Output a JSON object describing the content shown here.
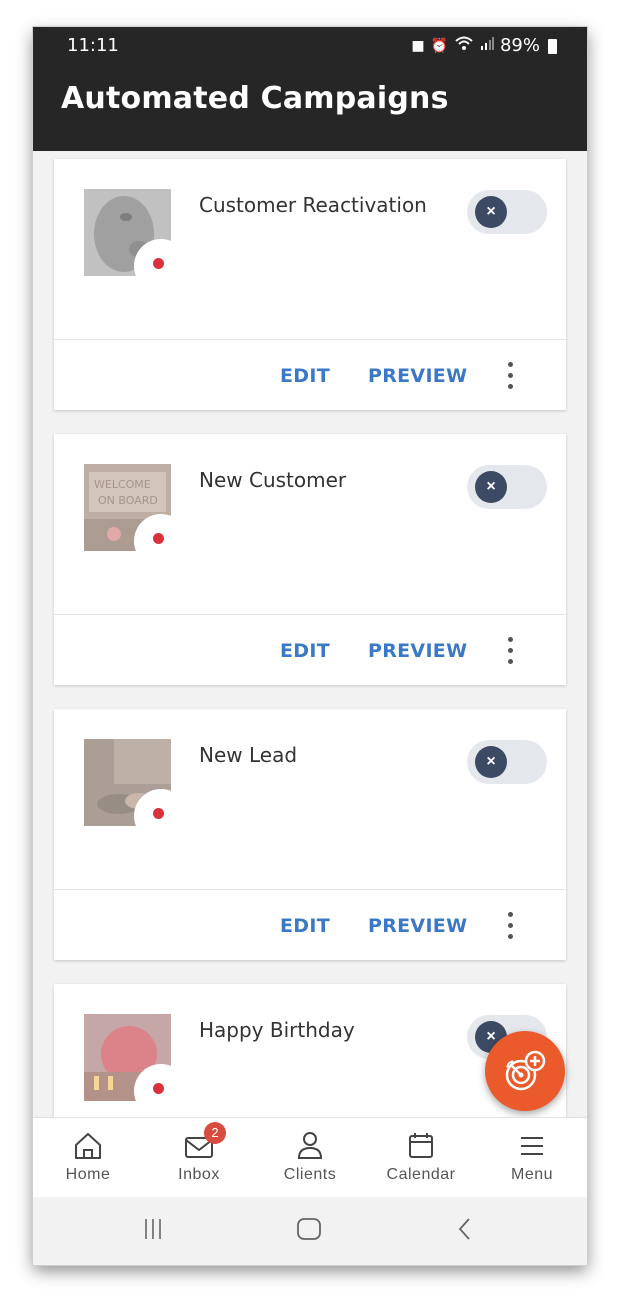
{
  "status_bar": {
    "time": "11:11",
    "battery": "89%"
  },
  "header": {
    "title": "Automated Campaigns"
  },
  "campaigns": [
    {
      "name": "Customer Reactivation",
      "enabled": false,
      "image": "dog-photo"
    },
    {
      "name": "New Customer",
      "enabled": false,
      "image": "welcome-on-board-mat-photo"
    },
    {
      "name": "New Lead",
      "enabled": false,
      "image": "handshake-photo"
    },
    {
      "name": "Happy Birthday",
      "enabled": false,
      "image": "birthday-cake-photo"
    }
  ],
  "actions": {
    "edit": "EDIT",
    "preview": "PREVIEW"
  },
  "toggle_off_glyph": "×",
  "nav": {
    "items": [
      {
        "label": "Home",
        "icon": "home-icon"
      },
      {
        "label": "Inbox",
        "icon": "mail-icon",
        "badge": "2"
      },
      {
        "label": "Clients",
        "icon": "person-icon"
      },
      {
        "label": "Calendar",
        "icon": "calendar-icon"
      },
      {
        "label": "Menu",
        "icon": "hamburger-icon"
      }
    ]
  },
  "colors": {
    "header_bg": "#262626",
    "accent_link": "#3b78c8",
    "fab": "#ea5a2b",
    "status_dot": "#d9323a",
    "toggle_knob": "#3d4a63",
    "badge": "#d94b3e"
  }
}
